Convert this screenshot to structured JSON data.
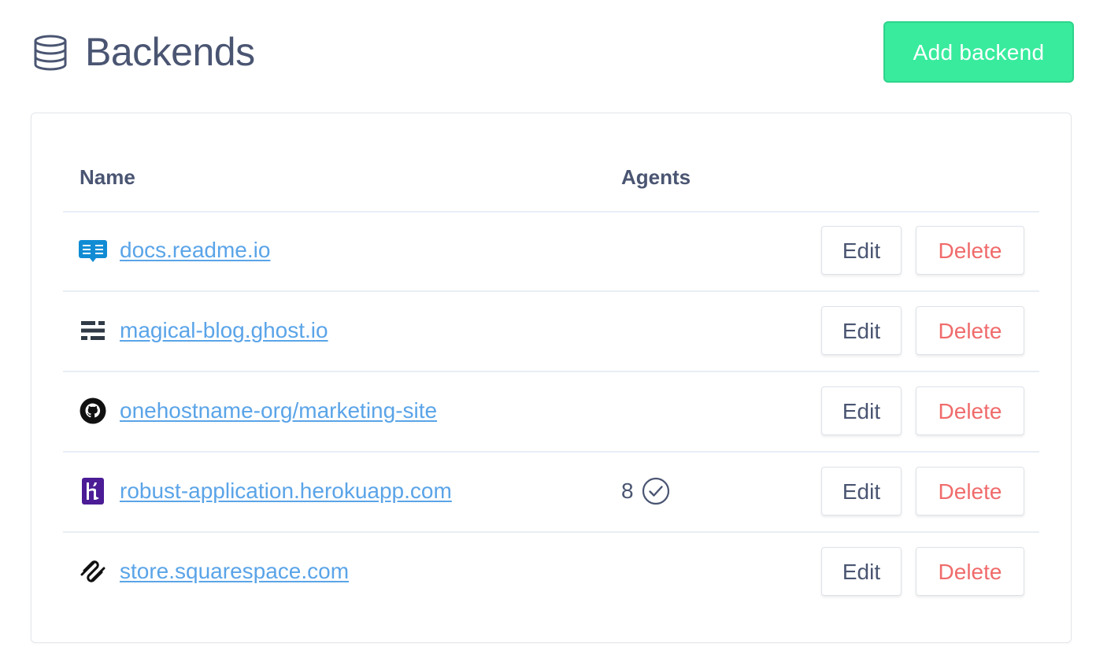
{
  "header": {
    "title": "Backends",
    "icon": "database-icon",
    "add_button_label": "Add backend"
  },
  "colors": {
    "accent_green": "#38eb9d",
    "link_blue": "#5aa4e8",
    "danger_red": "#f06b6b",
    "text": "#4a5572"
  },
  "table": {
    "columns": [
      "Name",
      "Agents"
    ],
    "edit_label": "Edit",
    "delete_label": "Delete",
    "rows": [
      {
        "name": "docs.readme.io",
        "icon": "readme-icon",
        "agents": ""
      },
      {
        "name": "magical-blog.ghost.io",
        "icon": "ghost-icon",
        "agents": ""
      },
      {
        "name": "onehostname-org/marketing-site",
        "icon": "github-icon",
        "agents": ""
      },
      {
        "name": "robust-application.herokuapp.com",
        "icon": "heroku-icon",
        "agents": "8",
        "agents_status_icon": "check-circle-icon"
      },
      {
        "name": "store.squarespace.com",
        "icon": "squarespace-icon",
        "agents": ""
      }
    ]
  }
}
